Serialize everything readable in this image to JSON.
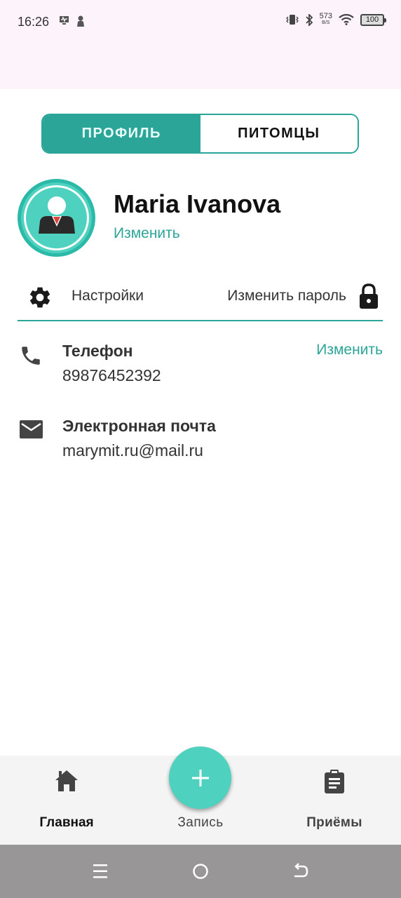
{
  "status_bar": {
    "time": "16:26",
    "net_speed_value": "573",
    "net_speed_unit": "B/S",
    "battery": "100"
  },
  "tabs": {
    "profile": "ПРОФИЛЬ",
    "pets": "ПИТОМЦЫ"
  },
  "profile": {
    "name": "Maria Ivanova",
    "edit_label": "Изменить"
  },
  "settings": {
    "settings_label": "Настройки",
    "password_label": "Изменить пароль"
  },
  "contacts": {
    "phone_title": "Телефон",
    "phone_value": "89876452392",
    "phone_edit": "Изменить",
    "email_title": "Электронная почта",
    "email_value": "marymit.ru@mail.ru"
  },
  "bottom_nav": {
    "home": "Главная",
    "add": "Запись",
    "appointments": "Приёмы"
  },
  "colors": {
    "accent": "#2ba597",
    "fab": "#4fd1bf",
    "status_bg": "#fdf4fb",
    "nav_bg": "#f4f4f4",
    "system_nav_bg": "#999698"
  },
  "icons": {
    "settings": "gear-icon",
    "password": "lock-icon",
    "phone": "phone-icon",
    "email": "email-icon",
    "home": "home-icon",
    "add": "plus-icon",
    "appointments": "clipboard-icon"
  }
}
